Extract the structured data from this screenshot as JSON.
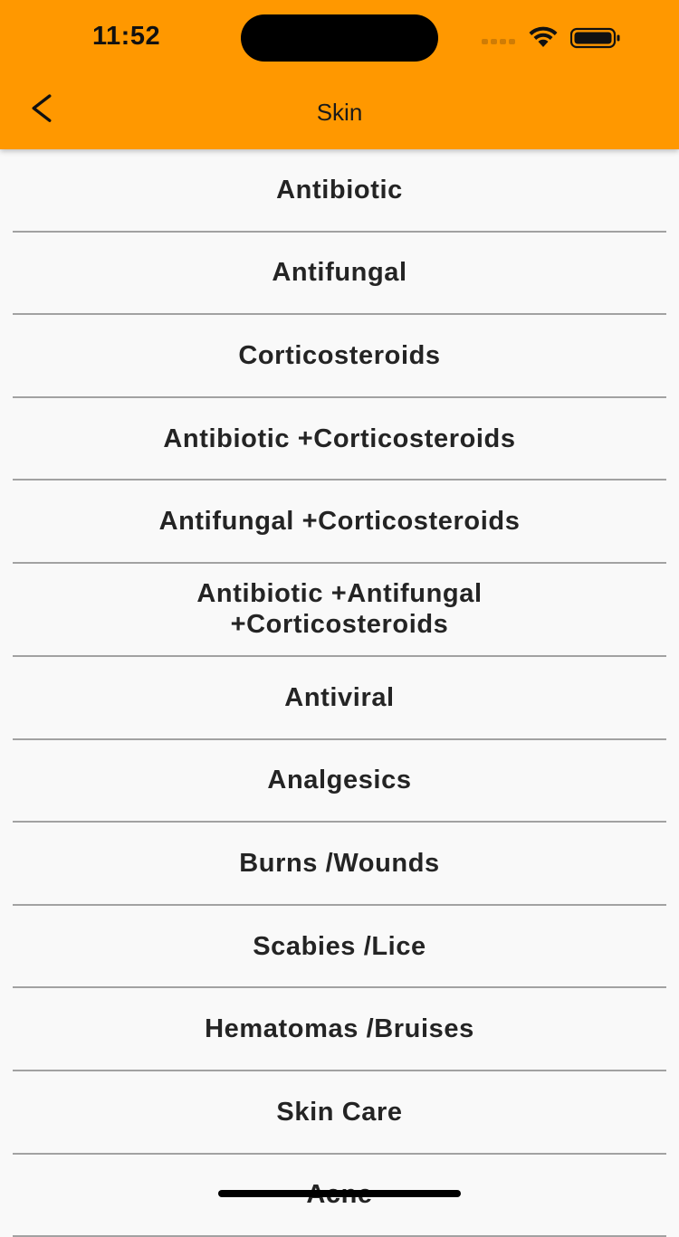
{
  "colors": {
    "header_bg": "#FF9800",
    "list_bg": "#F9F9F9",
    "divider": "#A2A2A2",
    "text": "#242424"
  },
  "status_bar": {
    "time": "11:52",
    "icons": [
      "cellular-signal-icon",
      "wifi-icon",
      "battery-icon"
    ]
  },
  "nav": {
    "back_icon": "chevron-left-icon",
    "title": "Skin"
  },
  "list": {
    "items": [
      {
        "label": "Antibiotic"
      },
      {
        "label": "Antifungal"
      },
      {
        "label": "Corticosteroids"
      },
      {
        "label": "Antibiotic +Corticosteroids"
      },
      {
        "label": "Antifungal +Corticosteroids"
      },
      {
        "label": "Antibiotic +Antifungal +Corticosteroids"
      },
      {
        "label": "Antiviral"
      },
      {
        "label": "Analgesics"
      },
      {
        "label": "Burns /Wounds"
      },
      {
        "label": "Scabies /Lice"
      },
      {
        "label": "Hematomas /Bruises"
      },
      {
        "label": "Skin Care"
      },
      {
        "label": "Acne"
      }
    ]
  }
}
